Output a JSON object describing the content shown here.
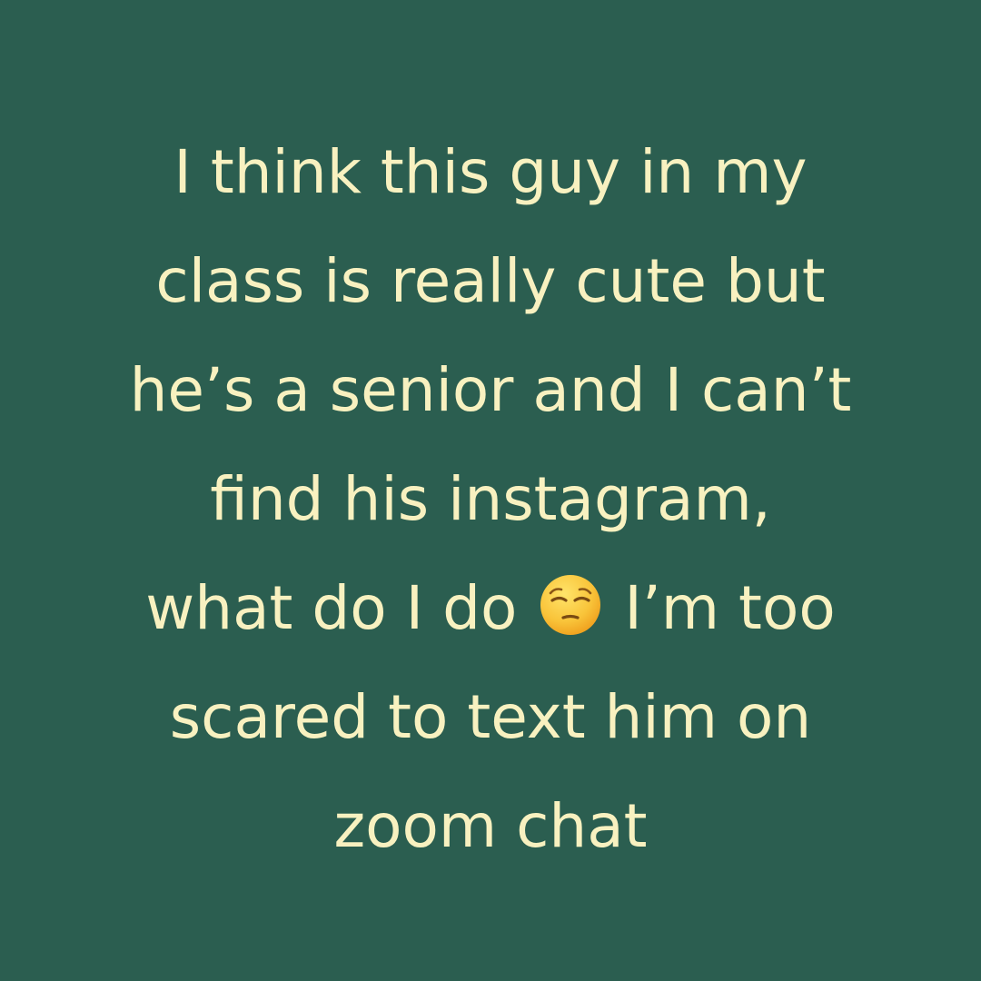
{
  "background_color": "#2b5e50",
  "text_color": "#f8f1c0",
  "quote": {
    "line1": "I think this guy in my",
    "line2": "class is really cute but",
    "line3": "he’s a senior and I can’t",
    "line4": "find his instagram,",
    "line5_before": "what do I do",
    "line5_after": "I’m too",
    "line6": "scared to text him on",
    "line7": "zoom chat",
    "emoji": "pensive-face-icon"
  }
}
